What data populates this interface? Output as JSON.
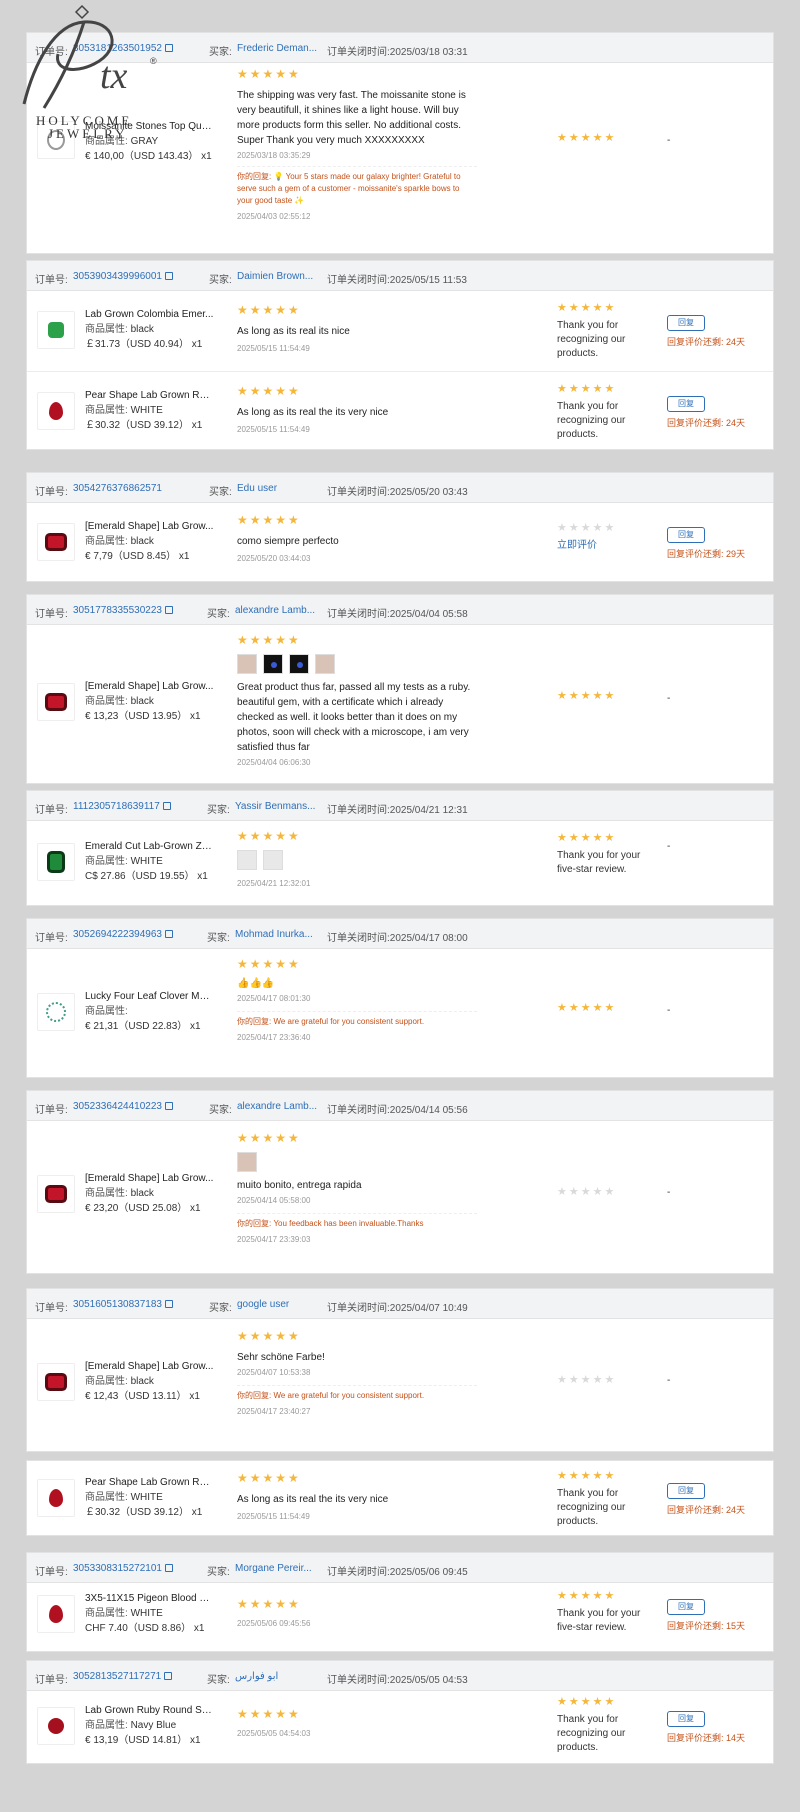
{
  "logo": {
    "mark": "Ptx",
    "line1": "HOLYCOME",
    "line2": "JEWELRY"
  },
  "labels": {
    "order_no": "订单号:",
    "buyer": "买家:",
    "close_time_prefix": "订单关闭时间:",
    "attr": "商品属性:",
    "your_reply": "你的回复:",
    "reply_button": "回复",
    "rate_now": "立即评价",
    "dash": "-"
  },
  "stars5": "★★★★★",
  "orders": [
    {
      "order_no": "3053181263501952",
      "buyer": "Frederic Deman...",
      "close_time": "订单关闭时间:2025/03/18 03:31",
      "items": [
        {
          "name": "Moissanite Stones Top Qual...",
          "attr": "GRAY",
          "price": "€ 140,00（USD  143.43） x1",
          "review": "The shipping was very fast. The moissanite stone is very beautifull, it shines like a light house. Will buy more products form this seller. No additional costs. Super Thank you very much XXXXXXXXX",
          "review_date": "2025/03/18 03:35:29",
          "reply": "你的回复: 💡 Your 5 stars made our galaxy brighter! Grateful to serve such a gem of a customer - moissanite's sparkle bows to your good taste ✨",
          "reply_date": "2025/04/03 02:55:12",
          "seller_text": "",
          "remain": ""
        }
      ]
    },
    {
      "order_no": "3053903439996001",
      "buyer": "Daimien Brown...",
      "close_time": "订单关闭时间:2025/05/15 11:53",
      "items": [
        {
          "name": "Lab Grown Colombia Emer...",
          "attr": "black",
          "price": "￡31.73（USD  40.94） x1",
          "review": "As long as its real its nice",
          "review_date": "2025/05/15 11:54:49",
          "seller_text": "Thank you for recognizing our products.",
          "remain": "回复评价还剩: 24天"
        },
        {
          "name": "Pear Shape Lab Grown Rub...",
          "attr": "WHITE",
          "price": "￡30.32（USD  39.12） x1",
          "review": "As long as its real the its very nice",
          "review_date": "2025/05/15 11:54:49",
          "seller_text": "Thank you for recognizing our products.",
          "remain": "回复评价还剩: 24天"
        }
      ]
    },
    {
      "order_no": "3054276376862571",
      "buyer": "Edu user",
      "close_time": "订单关闭时间:2025/05/20 03:43",
      "items": [
        {
          "name": "[Emerald Shape] Lab Grow...",
          "attr": "black",
          "price": "€ 7,79（USD  8.45） x1",
          "review": "como siempre perfecto",
          "review_date": "2025/05/20 03:44:03",
          "seller_text": "",
          "remain": "回复评价还剩: 29天"
        }
      ]
    },
    {
      "order_no": "3051778335530223",
      "buyer": "alexandre Lamb...",
      "close_time": "订单关闭时间:2025/04/04 05:58",
      "items": [
        {
          "name": "[Emerald Shape] Lab Grow...",
          "attr": "black",
          "price": "€ 13,23（USD  13.95） x1",
          "review": "Great product thus far, passed all my tests as a ruby. beautiful gem, with a certificate which i already checked as well. it looks better than it does on my photos, soon will check with a microscope, i am very satisfied thus far",
          "review_date": "2025/04/04 06:06:30"
        }
      ]
    },
    {
      "order_no": "1112305718639117",
      "buyer": "Yassir Benmans...",
      "close_time": "订单关闭时间:2025/04/21 12:31",
      "items": [
        {
          "name": "Emerald Cut Lab-Grown Za...",
          "attr": "WHITE",
          "price": "C$ 27.86（USD  19.55） x1",
          "review_date": "2025/04/21 12:32:01",
          "seller_text": "Thank you for your five-star review."
        }
      ]
    },
    {
      "order_no": "3052694222394963",
      "buyer": "Mohmad Inurka...",
      "close_time": "订单关闭时间:2025/04/17 08:00",
      "items": [
        {
          "name": "Lucky Four Leaf Clover Mois...",
          "attr": "",
          "price": "€ 21,31（USD  22.83） x1",
          "review": "👍👍👍",
          "review_date": "2025/04/17 08:01:30",
          "reply": "你的回复:   We are grateful for you consistent support.",
          "reply_date": "2025/04/17 23:36:40"
        }
      ]
    },
    {
      "order_no": "3052336424410223",
      "buyer": "alexandre Lamb...",
      "close_time": "订单关闭时间:2025/04/14 05:56",
      "items": [
        {
          "name": "[Emerald Shape] Lab Grow...",
          "attr": "black",
          "price": "€ 23,20（USD  25.08） x1",
          "review": "muito bonito, entrega rapida",
          "review_date": "2025/04/14 05:58:00",
          "reply": "你的回复:   You feedback has been invaluable.Thanks",
          "reply_date": "2025/04/17 23:39:03"
        }
      ]
    },
    {
      "order_no": "3051605130837183",
      "buyer": "google user",
      "close_time": "订单关闭时间:2025/04/07 10:49",
      "items": [
        {
          "name": "[Emerald Shape] Lab Grow...",
          "attr": "black",
          "price": "€ 12,43（USD  13.11） x1",
          "review": "Sehr schöne Farbe!",
          "review_date": "2025/04/07 10:53:38",
          "reply": "你的回复:    We are grateful for you consistent support.",
          "reply_date": "2025/04/17 23:40:27"
        }
      ]
    },
    {
      "items": [
        {
          "name": "Pear Shape Lab Grown Rub...",
          "attr": "WHITE",
          "price": "￡30.32（USD  39.12） x1",
          "review": "As long as its real the its very nice",
          "review_date": "2025/05/15 11:54:49",
          "seller_text": "Thank you for recognizing our products.",
          "remain": "回复评价还剩: 24天"
        }
      ]
    },
    {
      "order_no": "3053308315272101",
      "buyer": "Morgane Pereir...",
      "close_time": "订单关闭时间:2025/05/06 09:45",
      "items": [
        {
          "name": "3X5-11X15 Pigeon Blood Re...",
          "attr": "WHITE",
          "price": "CHF 7.40（USD  8.86） x1",
          "review_date": "2025/05/06 09:45:56",
          "seller_text": "Thank you for your five-star review.",
          "remain": "回复评价还剩: 15天"
        }
      ]
    },
    {
      "order_no": "3052813527117271",
      "buyer": "ابو فوارس",
      "close_time": "订单关闭时间:2025/05/05 04:53",
      "items": [
        {
          "name": "Lab Grown Ruby Round Sha...",
          "attr": "Navy Blue",
          "price": "€ 13,19（USD  14.81） x1",
          "review_date": "2025/05/05 04:54:03",
          "seller_text": "Thank you for recognizing our products.",
          "remain": "回复评价还剩: 14天"
        }
      ]
    }
  ]
}
